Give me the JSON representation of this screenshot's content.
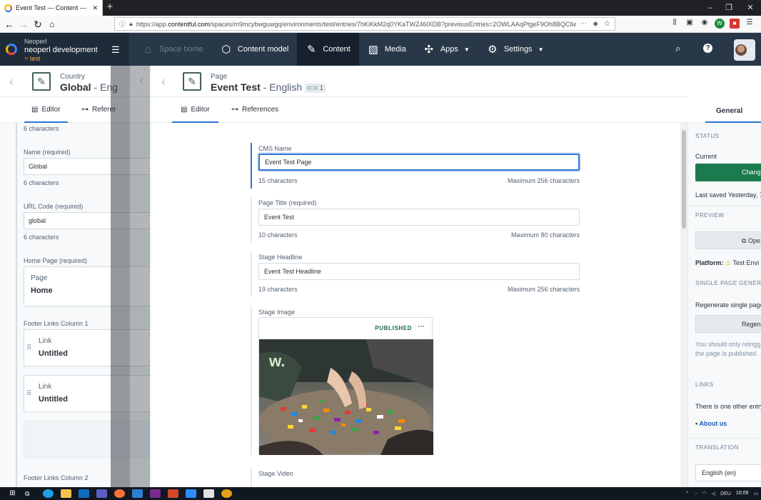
{
  "browser": {
    "tab_title": "Event Test — Content — neope",
    "url_prefix": "https://app.",
    "url_domain": "contentful.com",
    "url_rest": "/spaces/m9mcybwguwgq/environments/test/entries/7hKiKkM2q0YKaTWZ46lXDB?previousEntries=2OWLAAqPtgeF9Oh8BQC6w",
    "page_action": "⋯"
  },
  "header": {
    "org": "Neoperl",
    "space": "neoperl development",
    "environment": "test",
    "nav": [
      "Space home",
      "Content model",
      "Content",
      "Media",
      "Apps",
      "Settings"
    ]
  },
  "left_entry": {
    "type": "Country",
    "title": "Global",
    "locale": "- Eng",
    "tab_editor": "Editor",
    "tab_references": "Referer",
    "top_count": "6 characters",
    "fields": [
      {
        "label": "Name (required)",
        "value": "Global",
        "count": "6 characters"
      },
      {
        "label": "URL Code (required)",
        "value": "global",
        "count": "6 characters"
      }
    ],
    "home_page": {
      "label": "Home Page (required)",
      "type": "Page",
      "title": "Home"
    },
    "footer1": {
      "label": "Footer Links Column 1",
      "links": [
        {
          "type": "Link",
          "title": "Untitled"
        },
        {
          "type": "Link",
          "title": "Untitled"
        }
      ]
    },
    "footer2": {
      "label": "Footer Links Column 2"
    }
  },
  "entry": {
    "type": "Page",
    "title": "Event Test",
    "locale": "- English",
    "ref_count": "1",
    "tab_editor": "Editor",
    "tab_references": "References",
    "fields": [
      {
        "label": "CMS Name",
        "value": "Event Test Page",
        "count": "15 characters",
        "max": "Maximum 256 characters"
      },
      {
        "label": "Page Title (required)",
        "value": "Event Test",
        "count": "10 characters",
        "max": "Maximum 80 characters"
      },
      {
        "label": "Stage Headline",
        "value": "Event Test Headline",
        "count": "19 characters",
        "max": "Maximum 256 characters"
      }
    ],
    "stage_image_label": "Stage Image",
    "asset_status": "PUBLISHED",
    "stage_video_label": "Stage Video"
  },
  "sidebar": {
    "tab": "General",
    "status_heading": "STATUS",
    "current": "Current",
    "change_button": "Chang",
    "last_saved": "Last saved Yesterday, 7:",
    "preview_heading": "PREVIEW",
    "open_button": "Ope",
    "platform_label": "Platform:",
    "platform_value": "Test Envi",
    "generator_heading": "SINGLE PAGE GENERATO",
    "regenerate_text": "Regenerate single page",
    "regenerate_button": "Regener",
    "note_line1": "You should only retrigg",
    "note_line2": "the page is published.",
    "links_heading": "LINKS",
    "links_text": "There is one other entry",
    "link_item": "About us",
    "translation_heading": "TRANSLATION",
    "translation_value": "English (en)"
  },
  "taskbar": {
    "lang": "DEU",
    "time": "10:09"
  },
  "colors": {
    "header_bg": "#283848",
    "accent_blue": "#2e75d4",
    "publish_green": "#1c7a4f"
  }
}
